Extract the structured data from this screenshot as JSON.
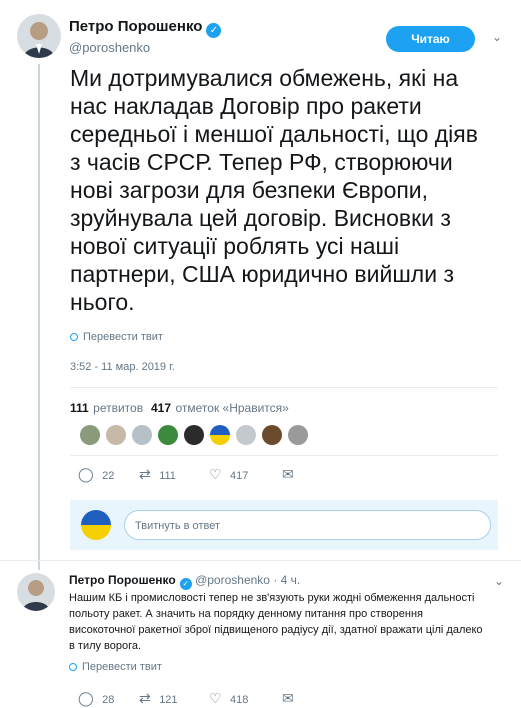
{
  "tweet": {
    "author_name": "Петро Порошенко",
    "author_handle": "@poroshenko",
    "follow_label": "Читаю",
    "text": "Ми дотримувалися обмежень, які на нас накладав Договір про ракети середньої і меншої дальності, що діяв з часів СРСР. Тепер РФ, створюючи нові загрози для безпеки Європи, зруйнувала цей договір. Висновки з нової ситуації роблять усі наші партнери, США юридично вийшли з нього.",
    "translate_label": "Перевести твит",
    "timestamp": "3:52 - 11 мар. 2019 г.",
    "retweets_count": "111",
    "retweets_label": "ретвитов",
    "likes_count": "417",
    "likes_label": "отметок «Нравится»",
    "actions": {
      "replies": "22",
      "retweets": "111",
      "likes": "417"
    }
  },
  "reply_placeholder": "Твитнуть в ответ",
  "reply_tweet": {
    "author_name": "Петро Порошенко",
    "author_handle": "@poroshenko",
    "time": "· 4 ч.",
    "text": "Нашим КБ і промисловості тепер не зв'язують руки жодні обмеження дальності польоту ракет. А значить на порядку денному питання про створення високоточної ракетної зброї підвищеного радіусу дії, здатної вражати цілі далеко в тилу ворога.",
    "translate_label": "Перевести твит",
    "actions": {
      "replies": "28",
      "retweets": "121",
      "likes": "418"
    }
  },
  "colors": {
    "accent": "#1da1f2",
    "text": "#14171a",
    "muted": "#657786"
  }
}
